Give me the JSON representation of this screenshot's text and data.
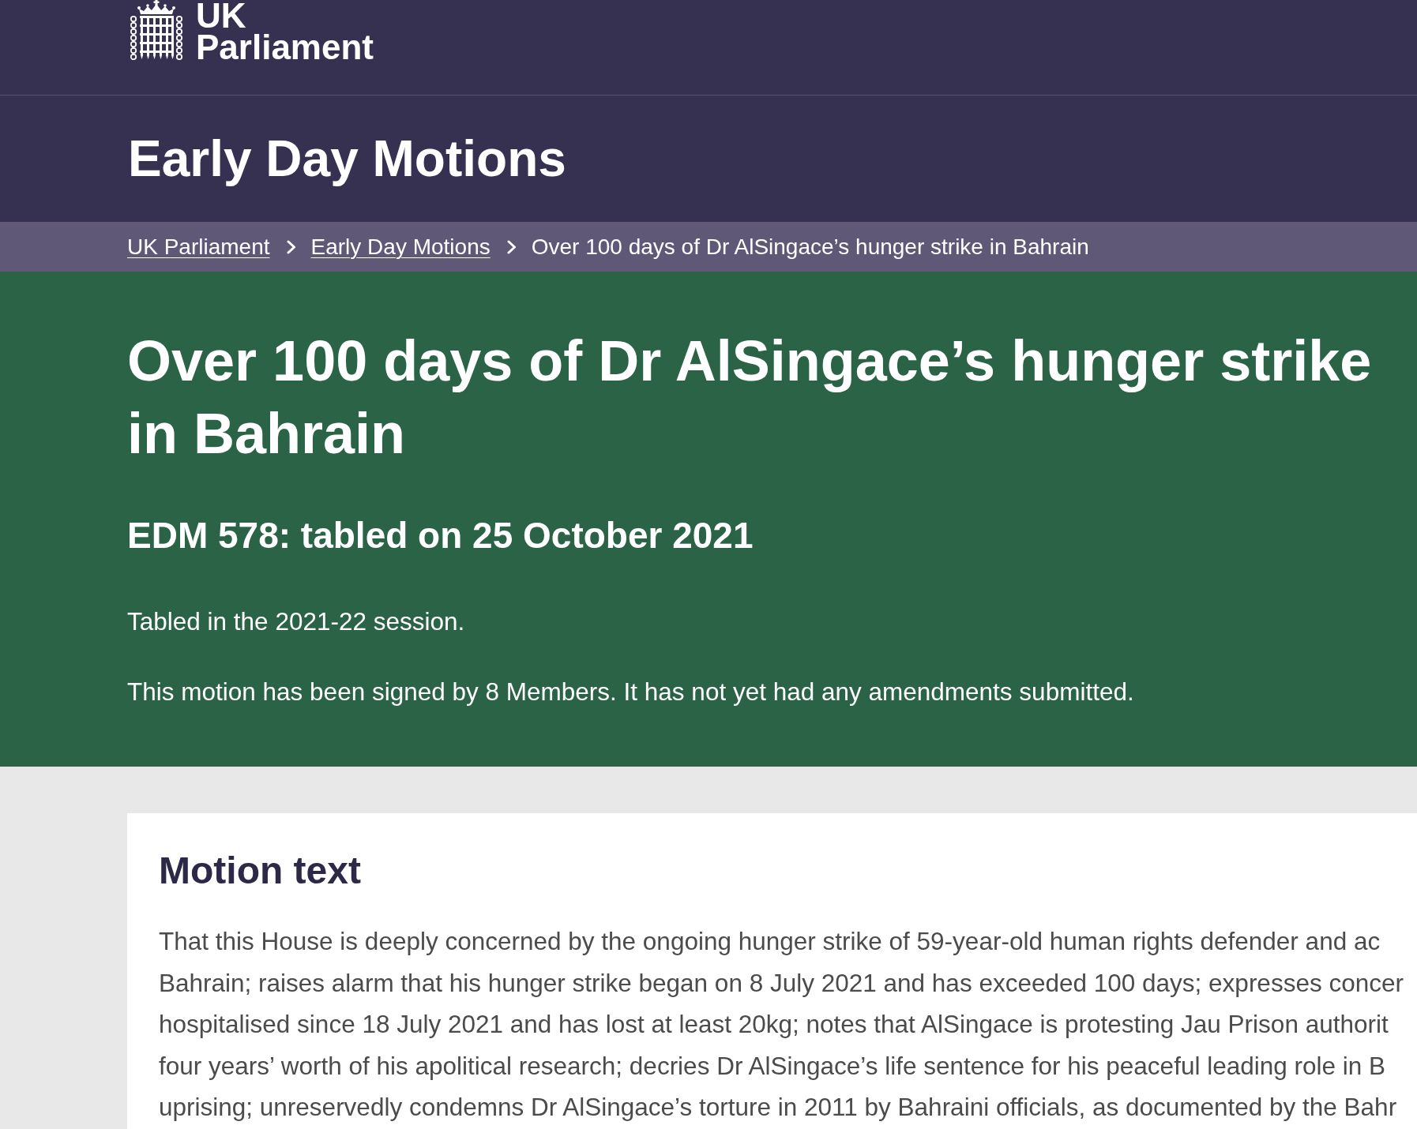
{
  "header": {
    "logo_text": "UK Parliament"
  },
  "section_title": "Early Day Motions",
  "breadcrumbs": [
    {
      "label": "UK Parliament",
      "kind": "link"
    },
    {
      "label": "Early Day Motions",
      "kind": "link"
    },
    {
      "label": "Over 100 days of Dr AlSingace’s hunger strike in Bahrain",
      "kind": "current"
    }
  ],
  "motion": {
    "title": "Over 100 days of Dr AlSingace’s hunger strike in Bahrain",
    "reference": "EDM 578: tabled on 25 October 2021",
    "session_note": "Tabled in the 2021-22 session.",
    "signatures_note": "This motion has been signed by 8 Members. It has not yet had any amendments submitted."
  },
  "motion_text": {
    "heading": "Motion text",
    "lines": [
      "That this House is deeply concerned by the ongoing hunger strike of 59-year-old human rights defender and ac",
      "Bahrain; raises alarm that his hunger strike began on 8 July 2021 and has exceeded 100 days; expresses concer",
      "hospitalised since 18 July 2021 and has lost at least 20kg; notes that AlSingace is protesting Jau Prison authorit",
      "four years’ worth of his apolitical research; decries Dr AlSingace’s life sentence for his peaceful leading role in B",
      "uprising; unreservedly condemns Dr AlSingace’s torture in 2011 by Bahraini officials, as documented by the Bahr"
    ]
  }
}
